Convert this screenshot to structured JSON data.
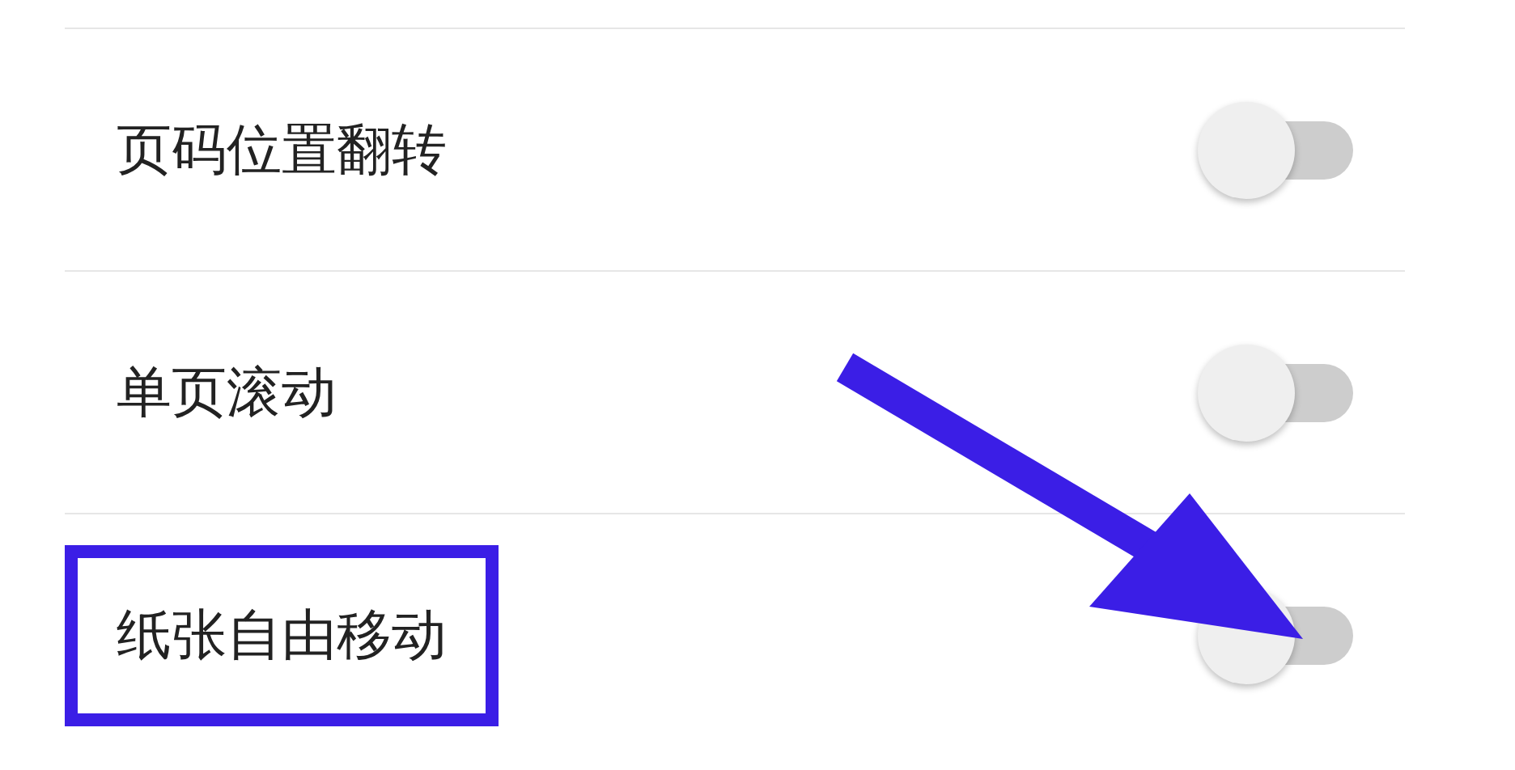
{
  "settings": [
    {
      "label": "页码位置翻转",
      "on": false,
      "boxed": false,
      "arrowed": false
    },
    {
      "label": "单页滚动",
      "on": false,
      "boxed": false,
      "arrowed": false
    },
    {
      "label": "纸张自由移动",
      "on": false,
      "boxed": true,
      "arrowed": true
    }
  ]
}
